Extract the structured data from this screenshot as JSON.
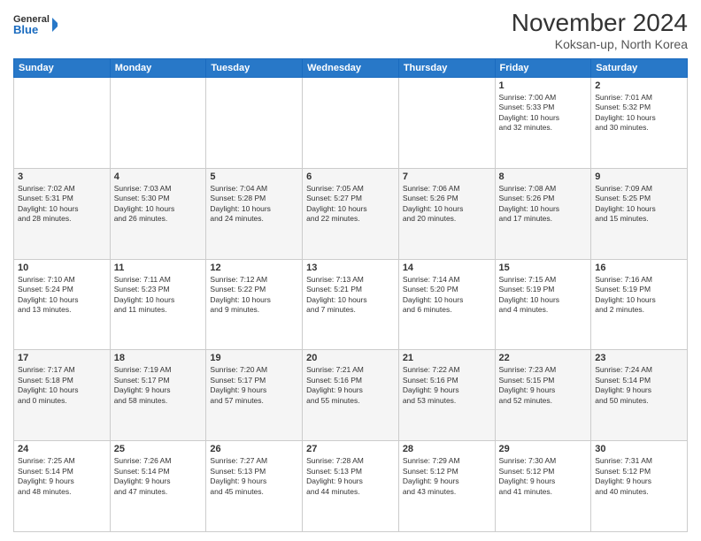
{
  "header": {
    "logo_line1": "General",
    "logo_line2": "Blue",
    "month": "November 2024",
    "location": "Koksan-up, North Korea"
  },
  "weekdays": [
    "Sunday",
    "Monday",
    "Tuesday",
    "Wednesday",
    "Thursday",
    "Friday",
    "Saturday"
  ],
  "weeks": [
    [
      {
        "day": "",
        "info": ""
      },
      {
        "day": "",
        "info": ""
      },
      {
        "day": "",
        "info": ""
      },
      {
        "day": "",
        "info": ""
      },
      {
        "day": "",
        "info": ""
      },
      {
        "day": "1",
        "info": "Sunrise: 7:00 AM\nSunset: 5:33 PM\nDaylight: 10 hours\nand 32 minutes."
      },
      {
        "day": "2",
        "info": "Sunrise: 7:01 AM\nSunset: 5:32 PM\nDaylight: 10 hours\nand 30 minutes."
      }
    ],
    [
      {
        "day": "3",
        "info": "Sunrise: 7:02 AM\nSunset: 5:31 PM\nDaylight: 10 hours\nand 28 minutes."
      },
      {
        "day": "4",
        "info": "Sunrise: 7:03 AM\nSunset: 5:30 PM\nDaylight: 10 hours\nand 26 minutes."
      },
      {
        "day": "5",
        "info": "Sunrise: 7:04 AM\nSunset: 5:28 PM\nDaylight: 10 hours\nand 24 minutes."
      },
      {
        "day": "6",
        "info": "Sunrise: 7:05 AM\nSunset: 5:27 PM\nDaylight: 10 hours\nand 22 minutes."
      },
      {
        "day": "7",
        "info": "Sunrise: 7:06 AM\nSunset: 5:26 PM\nDaylight: 10 hours\nand 20 minutes."
      },
      {
        "day": "8",
        "info": "Sunrise: 7:08 AM\nSunset: 5:26 PM\nDaylight: 10 hours\nand 17 minutes."
      },
      {
        "day": "9",
        "info": "Sunrise: 7:09 AM\nSunset: 5:25 PM\nDaylight: 10 hours\nand 15 minutes."
      }
    ],
    [
      {
        "day": "10",
        "info": "Sunrise: 7:10 AM\nSunset: 5:24 PM\nDaylight: 10 hours\nand 13 minutes."
      },
      {
        "day": "11",
        "info": "Sunrise: 7:11 AM\nSunset: 5:23 PM\nDaylight: 10 hours\nand 11 minutes."
      },
      {
        "day": "12",
        "info": "Sunrise: 7:12 AM\nSunset: 5:22 PM\nDaylight: 10 hours\nand 9 minutes."
      },
      {
        "day": "13",
        "info": "Sunrise: 7:13 AM\nSunset: 5:21 PM\nDaylight: 10 hours\nand 7 minutes."
      },
      {
        "day": "14",
        "info": "Sunrise: 7:14 AM\nSunset: 5:20 PM\nDaylight: 10 hours\nand 6 minutes."
      },
      {
        "day": "15",
        "info": "Sunrise: 7:15 AM\nSunset: 5:19 PM\nDaylight: 10 hours\nand 4 minutes."
      },
      {
        "day": "16",
        "info": "Sunrise: 7:16 AM\nSunset: 5:19 PM\nDaylight: 10 hours\nand 2 minutes."
      }
    ],
    [
      {
        "day": "17",
        "info": "Sunrise: 7:17 AM\nSunset: 5:18 PM\nDaylight: 10 hours\nand 0 minutes."
      },
      {
        "day": "18",
        "info": "Sunrise: 7:19 AM\nSunset: 5:17 PM\nDaylight: 9 hours\nand 58 minutes."
      },
      {
        "day": "19",
        "info": "Sunrise: 7:20 AM\nSunset: 5:17 PM\nDaylight: 9 hours\nand 57 minutes."
      },
      {
        "day": "20",
        "info": "Sunrise: 7:21 AM\nSunset: 5:16 PM\nDaylight: 9 hours\nand 55 minutes."
      },
      {
        "day": "21",
        "info": "Sunrise: 7:22 AM\nSunset: 5:16 PM\nDaylight: 9 hours\nand 53 minutes."
      },
      {
        "day": "22",
        "info": "Sunrise: 7:23 AM\nSunset: 5:15 PM\nDaylight: 9 hours\nand 52 minutes."
      },
      {
        "day": "23",
        "info": "Sunrise: 7:24 AM\nSunset: 5:14 PM\nDaylight: 9 hours\nand 50 minutes."
      }
    ],
    [
      {
        "day": "24",
        "info": "Sunrise: 7:25 AM\nSunset: 5:14 PM\nDaylight: 9 hours\nand 48 minutes."
      },
      {
        "day": "25",
        "info": "Sunrise: 7:26 AM\nSunset: 5:14 PM\nDaylight: 9 hours\nand 47 minutes."
      },
      {
        "day": "26",
        "info": "Sunrise: 7:27 AM\nSunset: 5:13 PM\nDaylight: 9 hours\nand 45 minutes."
      },
      {
        "day": "27",
        "info": "Sunrise: 7:28 AM\nSunset: 5:13 PM\nDaylight: 9 hours\nand 44 minutes."
      },
      {
        "day": "28",
        "info": "Sunrise: 7:29 AM\nSunset: 5:12 PM\nDaylight: 9 hours\nand 43 minutes."
      },
      {
        "day": "29",
        "info": "Sunrise: 7:30 AM\nSunset: 5:12 PM\nDaylight: 9 hours\nand 41 minutes."
      },
      {
        "day": "30",
        "info": "Sunrise: 7:31 AM\nSunset: 5:12 PM\nDaylight: 9 hours\nand 40 minutes."
      }
    ]
  ]
}
